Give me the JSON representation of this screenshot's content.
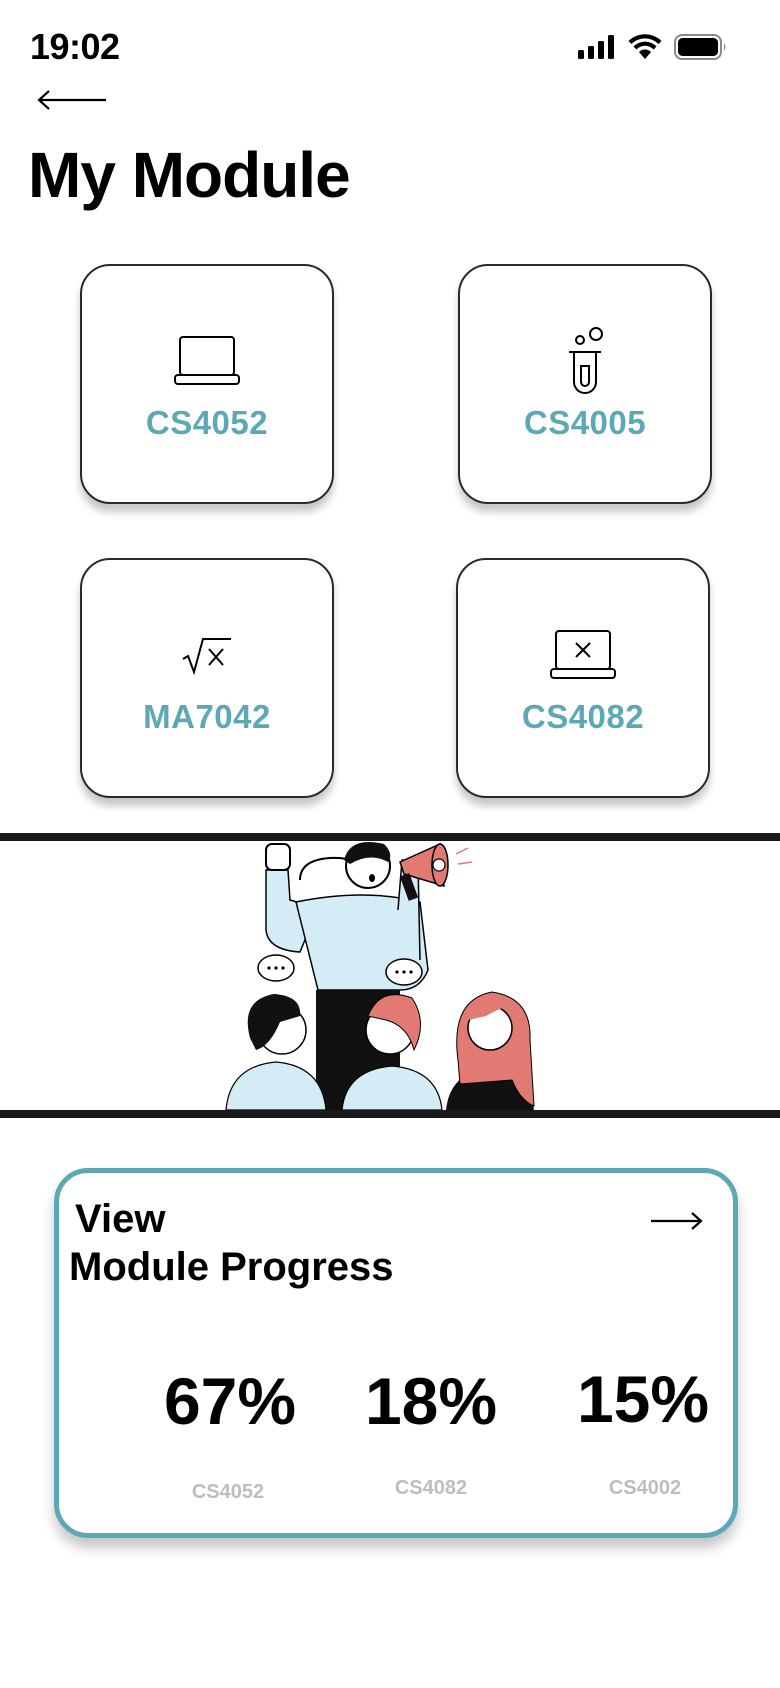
{
  "status_bar": {
    "time": "19:02"
  },
  "header": {
    "title": "My Module"
  },
  "modules": [
    {
      "code": "CS4052",
      "icon": "laptop-icon"
    },
    {
      "code": "CS4005",
      "icon": "test-tube-icon"
    },
    {
      "code": "MA7042",
      "icon": "math-sqrt-icon"
    },
    {
      "code": "CS4082",
      "icon": "laptop-x-icon"
    }
  ],
  "progress": {
    "title_line1": "View",
    "title_line2": "Module Progress",
    "items": [
      {
        "value": "67%",
        "module": "CS4052"
      },
      {
        "value": "18%",
        "module": "CS4082"
      },
      {
        "value": "15%",
        "module": "CS4002"
      }
    ]
  },
  "colors": {
    "accent": "#5da8b5",
    "illustration_blue": "#d3ecf5",
    "illustration_red": "#e07a73"
  }
}
